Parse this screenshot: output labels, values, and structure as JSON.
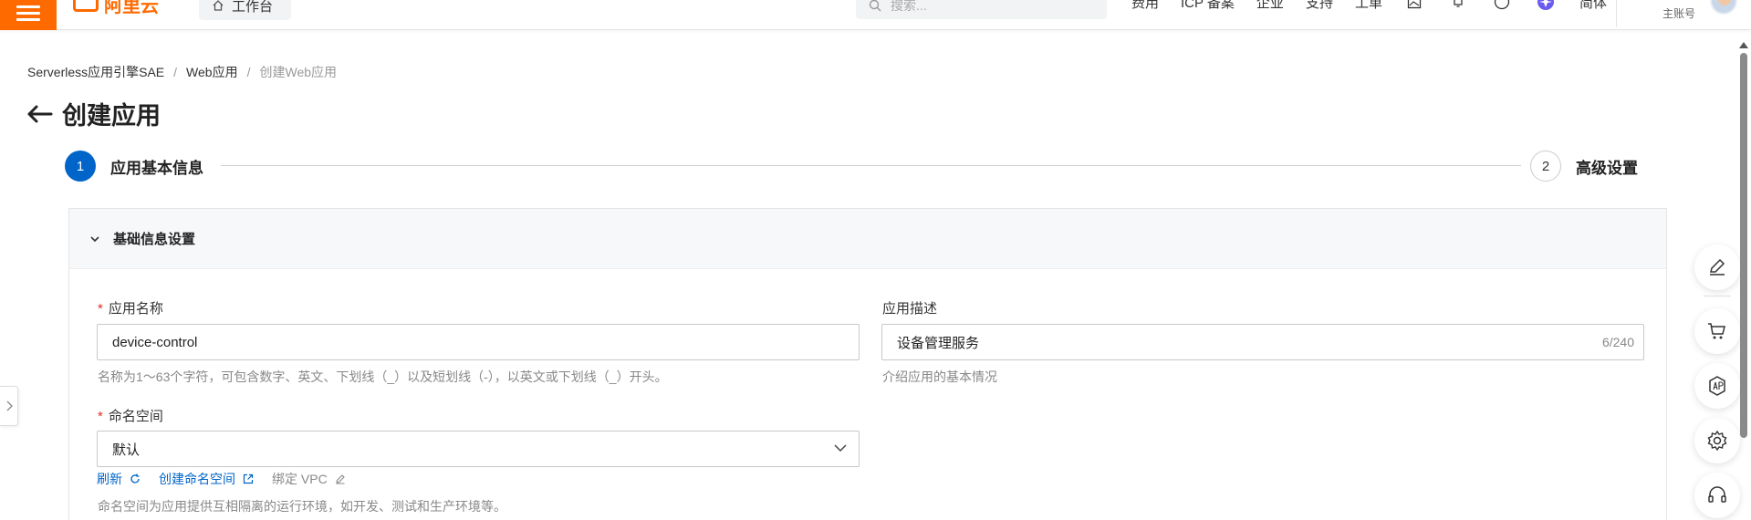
{
  "topbar": {
    "logo_text": "阿里云",
    "workbench_label": "工作台",
    "search_placeholder": "搜索...",
    "nav_links": [
      "费用",
      "ICP 备案",
      "企业",
      "支持",
      "工单"
    ],
    "language": "简体",
    "account_label": "主账号",
    "brand_color": "#ff6a00"
  },
  "breadcrumb": {
    "items": [
      "Serverless应用引擎SAE",
      "Web应用",
      "创建Web应用"
    ],
    "separator": "/"
  },
  "page": {
    "title": "创建应用"
  },
  "steps": [
    {
      "number": "1",
      "label": "应用基本信息",
      "state": "active"
    },
    {
      "number": "2",
      "label": "高级设置",
      "state": "pending"
    }
  ],
  "section": {
    "title": "基础信息设置",
    "expanded": true
  },
  "form": {
    "app_name": {
      "label": "应用名称",
      "required": true,
      "value": "device-control",
      "help": "名称为1～63个字符，可包含数字、英文、下划线（_）以及短划线（-），以英文或下划线（_）开头。"
    },
    "app_desc": {
      "label": "应用描述",
      "required": false,
      "value": "设备管理服务",
      "counter": "6/240",
      "help": "介绍应用的基本情况"
    },
    "namespace": {
      "label": "命名空间",
      "required": true,
      "value": "默认",
      "refresh_label": "刷新",
      "create_label": "创建命名空间",
      "bind_vpc_label": "绑定 VPC",
      "help": "命名空间为应用提供互相隔离的运行环境，如开发、测试和生产环境等。"
    }
  },
  "float_toolbar": [
    "edit-icon",
    "cart-icon",
    "api-icon",
    "gear-icon",
    "headset-icon"
  ],
  "colors": {
    "primary": "#0064c8",
    "required": "#d93026"
  }
}
